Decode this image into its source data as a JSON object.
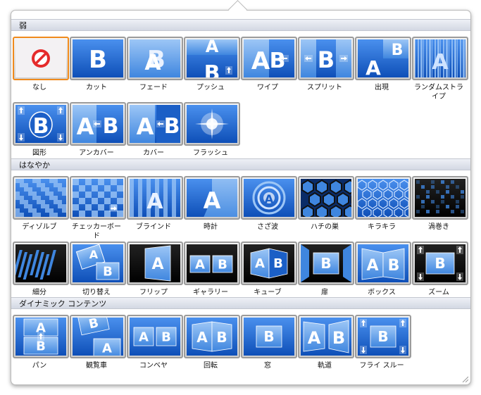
{
  "sections": [
    {
      "title": "弱",
      "items": [
        "なし",
        "カット",
        "フェード",
        "プッシュ",
        "ワイプ",
        "スプリット",
        "出現",
        "ランダムストライプ",
        "図形",
        "アンカバー",
        "カバー",
        "フラッシュ"
      ]
    },
    {
      "title": "はなやか",
      "items": [
        "ディゾルブ",
        "チェッカーボード",
        "ブラインド",
        "時計",
        "さざ波",
        "ハチの巣",
        "キラキラ",
        "渦巻き",
        "細分",
        "切り替え",
        "フリップ",
        "ギャラリー",
        "キューブ",
        "扉",
        "ボックス",
        "ズーム"
      ]
    },
    {
      "title": "ダイナミック コンテンツ",
      "items": [
        "パン",
        "観覧車",
        "コンベヤ",
        "回転",
        "窓",
        "軌道",
        "フライ スルー"
      ]
    }
  ],
  "selected": "なし",
  "colors": {
    "accent_blue": "#2a6fd6",
    "selection": "#f08a1c"
  }
}
